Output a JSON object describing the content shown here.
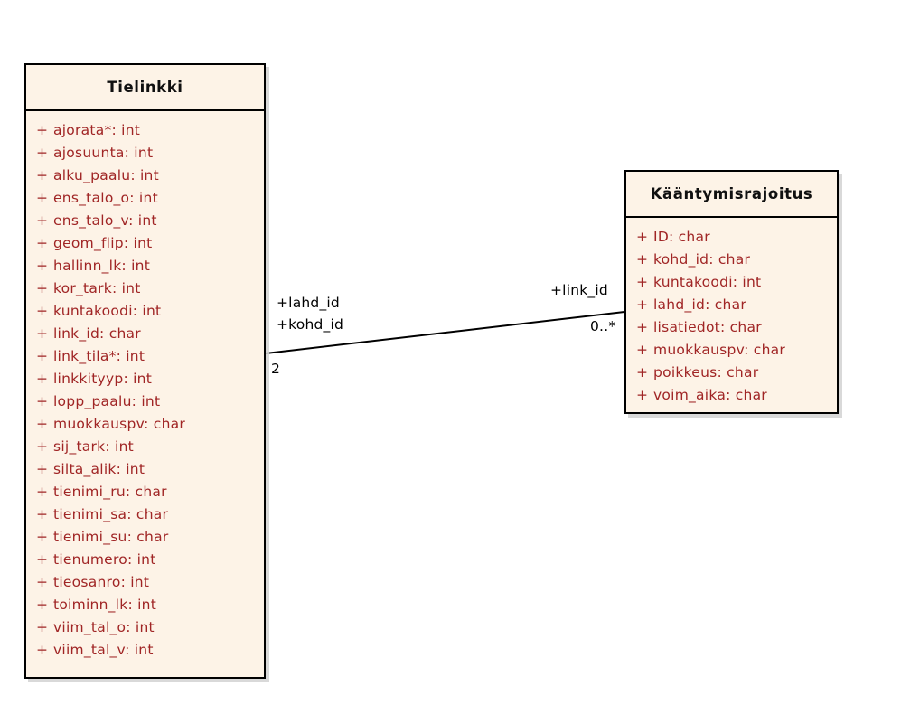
{
  "diagram": {
    "type": "uml-class-diagram",
    "background_color": "#ffffff",
    "class_fill_color": "#fdf3e7",
    "class_border_color": "#000000",
    "attribute_text_color": "#a02525",
    "title_text_color": "#101010",
    "line_color": "#000000"
  },
  "classes": [
    {
      "id": "tielinkki",
      "name": "Tielinkki",
      "attributes": [
        {
          "visibility": "+",
          "signature": "ajorata*: int"
        },
        {
          "visibility": "+",
          "signature": "ajosuunta: int"
        },
        {
          "visibility": "+",
          "signature": "alku_paalu: int"
        },
        {
          "visibility": "+",
          "signature": "ens_talo_o: int"
        },
        {
          "visibility": "+",
          "signature": "ens_talo_v: int"
        },
        {
          "visibility": "+",
          "signature": "geom_flip: int"
        },
        {
          "visibility": "+",
          "signature": "hallinn_lk: int"
        },
        {
          "visibility": "+",
          "signature": "kor_tark: int"
        },
        {
          "visibility": "+",
          "signature": "kuntakoodi: int"
        },
        {
          "visibility": "+",
          "signature": "link_id: char"
        },
        {
          "visibility": "+",
          "signature": "link_tila*: int"
        },
        {
          "visibility": "+",
          "signature": "linkkityyp: int"
        },
        {
          "visibility": "+",
          "signature": "lopp_paalu: int"
        },
        {
          "visibility": "+",
          "signature": "muokkauspv: char"
        },
        {
          "visibility": "+",
          "signature": "sij_tark: int"
        },
        {
          "visibility": "+",
          "signature": "silta_alik: int"
        },
        {
          "visibility": "+",
          "signature": "tienimi_ru: char"
        },
        {
          "visibility": "+",
          "signature": "tienimi_sa: char"
        },
        {
          "visibility": "+",
          "signature": "tienimi_su: char"
        },
        {
          "visibility": "+",
          "signature": "tienumero: int"
        },
        {
          "visibility": "+",
          "signature": "tieosanro: int"
        },
        {
          "visibility": "+",
          "signature": "toiminn_lk: int"
        },
        {
          "visibility": "+",
          "signature": "viim_tal_o: int"
        },
        {
          "visibility": "+",
          "signature": "viim_tal_v: int"
        }
      ]
    },
    {
      "id": "kaantymisrajoitus",
      "name": "Kääntymisrajoitus",
      "attributes": [
        {
          "visibility": "+",
          "signature": "ID: char"
        },
        {
          "visibility": "+",
          "signature": "kohd_id: char"
        },
        {
          "visibility": "+",
          "signature": "kuntakoodi: int"
        },
        {
          "visibility": "+",
          "signature": "lahd_id: char"
        },
        {
          "visibility": "+",
          "signature": "lisatiedot: char"
        },
        {
          "visibility": "+",
          "signature": "muokkauspv: char"
        },
        {
          "visibility": "+",
          "signature": "poikkeus: char"
        },
        {
          "visibility": "+",
          "signature": "voim_aika: char"
        }
      ]
    }
  ],
  "association": {
    "source_class": "Tielinkki",
    "target_class": "Kääntymisrajoitus",
    "source_role_labels": [
      "+lahd_id",
      "+kohd_id"
    ],
    "source_multiplicity": "2",
    "target_role_labels": [
      "+link_id"
    ],
    "target_multiplicity": "0..*"
  }
}
